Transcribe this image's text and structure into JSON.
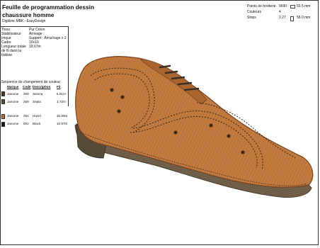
{
  "header": {
    "title_line1": "Feuille de programmation dessin",
    "title_line2": "chaussure homme",
    "subtitle": "Digitizer MBK - EasyDesign"
  },
  "stats": {
    "points_label": "Points de broderie",
    "points_value": "9690",
    "width_value": "93.5 mm",
    "colors_label": "Couleurs",
    "colors_value": "4",
    "changes_label": "Stops",
    "changes_value": "2.27",
    "height_value": "58.0 mm"
  },
  "meta": [
    {
      "key": "Tissu",
      "value": "Pur Coton"
    },
    {
      "key": "Stabilisateur",
      "value": "Arrivage :"
    },
    {
      "key": "Inique",
      "value": "Support : Arrachage x 2"
    },
    {
      "key": "Cadre",
      "value": "10x10"
    },
    {
      "key": "Longueur totale de fil dans la bobine",
      "value": "19.67m"
    }
  ],
  "sequence": {
    "title": "Séquence de changement de couleur",
    "headers": {
      "brand": "Marque",
      "code": "Code",
      "description": "Description",
      "thread": "Fil"
    },
    "rows": [
      {
        "brand": "Janome",
        "code": "259",
        "description": "Sienna",
        "thread": "6.91m",
        "color": "#4a3422"
      },
      {
        "brand": "Janome",
        "code": "259",
        "description": "Sepia",
        "thread": "1.72m",
        "color": "#5b4a35"
      },
      {
        "brand": "Janome",
        "code": "254",
        "description": "Hazel",
        "thread": "30.99m",
        "color": "#b86a2c"
      },
      {
        "brand": "Janome",
        "code": "002",
        "description": "Black",
        "thread": "10.97m",
        "color": "#111111"
      }
    ]
  },
  "colors": {
    "leather": "#c27a3f",
    "leather_dark": "#8a4f22",
    "sole": "#6b5a44",
    "heel": "#574a38",
    "lace": "#3b2f25",
    "stitch": "#3a2a1c"
  }
}
